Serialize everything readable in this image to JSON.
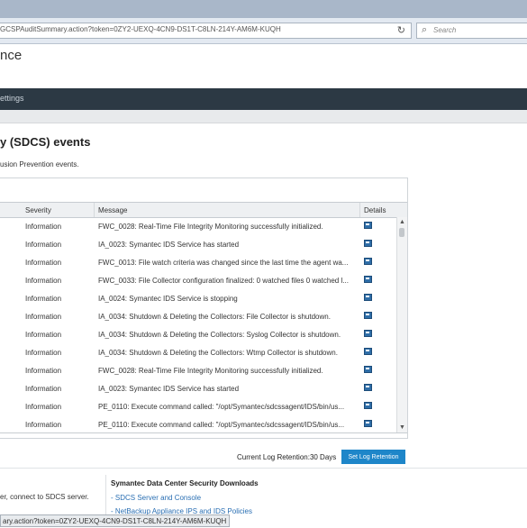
{
  "browser": {
    "url": "GCSPAuditSummary.action?token=0ZY2-UEXQ-4CN9-DS1T-C8LN-214Y-AM6M-KUQH",
    "search_placeholder": "Search",
    "status_url": "ary.action?token=0ZY2-UEXQ-4CN9-DS1T-C8LN-214Y-AM6M-KUQH"
  },
  "app": {
    "title": "nce",
    "nav_item": "ettings"
  },
  "page": {
    "heading": "y (SDCS) events",
    "subtext": "usion Prevention events."
  },
  "table": {
    "columns": [
      "Severity",
      "Message",
      "Details"
    ],
    "rows": [
      {
        "severity": "Information",
        "message": "FWC_0028: Real-Time File Integrity Monitoring successfully initialized."
      },
      {
        "severity": "Information",
        "message": "IA_0023: Symantec IDS Service has started"
      },
      {
        "severity": "Information",
        "message": "FWC_0013: File watch criteria was changed since the last time the agent wa..."
      },
      {
        "severity": "Information",
        "message": "FWC_0033: File Collector configuration finalized: 0 watched files 0 watched l..."
      },
      {
        "severity": "Information",
        "message": "IA_0024: Symantec IDS Service is stopping"
      },
      {
        "severity": "Information",
        "message": "IA_0034: Shutdown & Deleting the Collectors: File Collector is shutdown."
      },
      {
        "severity": "Information",
        "message": "IA_0034: Shutdown & Deleting the Collectors: Syslog Collector is shutdown."
      },
      {
        "severity": "Information",
        "message": "IA_0034: Shutdown & Deleting the Collectors: Wtmp Collector is shutdown."
      },
      {
        "severity": "Information",
        "message": "FWC_0028: Real-Time File Integrity Monitoring successfully initialized."
      },
      {
        "severity": "Information",
        "message": "IA_0023: Symantec IDS Service has started"
      },
      {
        "severity": "Information",
        "message": "PE_0110: Execute command called: \"/opt/Symantec/sdcssagent/IDS/bin/us..."
      },
      {
        "severity": "Information",
        "message": "PE_0110: Execute command called: \"/opt/Symantec/sdcssagent/IDS/bin/us..."
      }
    ]
  },
  "retention": {
    "label": "Current Log Retention:30 Days",
    "button": "Set Log Retention"
  },
  "footer": {
    "left_text": "er, connect to SDCS server.",
    "downloads_heading": "Symantec Data Center Security Downloads",
    "links": [
      "- SDCS Server and Console",
      "- NetBackup Appliance IPS and IDS Policies"
    ]
  },
  "colors": {
    "nav_bg": "#2c3944",
    "accent_button": "#1e86c9",
    "link": "#2a6fb3"
  }
}
